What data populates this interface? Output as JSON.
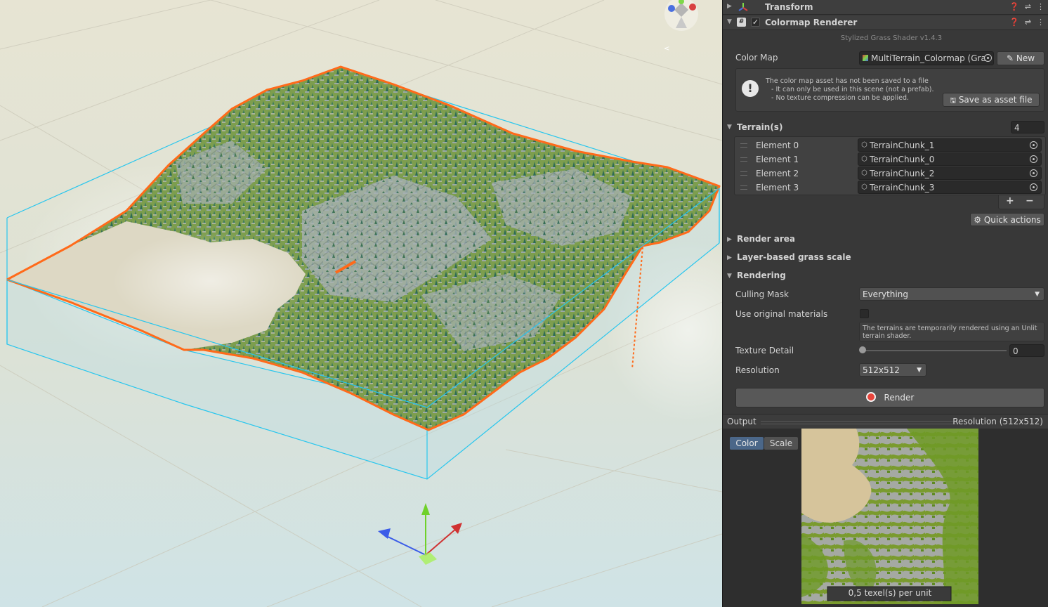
{
  "inspector": {
    "transform": {
      "title": "Transform"
    },
    "component": {
      "title": "Colormap Renderer",
      "version": "Stylized Grass Shader v1.4.3",
      "color_map": {
        "label": "Color Map",
        "value": "MultiTerrain_Colormap (Gras",
        "new_label": "New"
      },
      "warning": {
        "line1": "The color map asset has not been saved to a file",
        "line2": "- It can only be used in this scene (not a prefab).",
        "line3": "- No texture compression can be applied.",
        "save_label": "Save as asset file"
      },
      "terrains": {
        "label": "Terrain(s)",
        "count": "4",
        "elements": [
          {
            "label": "Element 0",
            "value": "TerrainChunk_1"
          },
          {
            "label": "Element 1",
            "value": "TerrainChunk_0"
          },
          {
            "label": "Element 2",
            "value": "TerrainChunk_2"
          },
          {
            "label": "Element 3",
            "value": "TerrainChunk_3"
          }
        ],
        "add": "+",
        "remove": "−"
      },
      "quick_actions": "Quick actions",
      "render_area": "Render area",
      "layer_scale": "Layer-based grass scale",
      "rendering": {
        "label": "Rendering",
        "culling_mask_label": "Culling Mask",
        "culling_mask_value": "Everything",
        "use_original_label": "Use original materials",
        "use_original_checked": false,
        "note_line1": "The terrains are temporarily rendered using an Unlit",
        "note_line2": "terrain shader.",
        "texture_detail_label": "Texture Detail",
        "texture_detail_value": "0",
        "resolution_label": "Resolution",
        "resolution_value": "512x512"
      },
      "render_button": "Render",
      "output": {
        "label": "Output",
        "resolution": "Resolution (512x512)",
        "tabs": [
          "Color",
          "Scale"
        ],
        "active_tab": "Color",
        "texel_label": "0,5 texel(s) per unit"
      }
    }
  },
  "colors": {
    "selection_orange": "#ff6a1a",
    "bounds_cyan": "#27c6ee",
    "accent_blue": "#4b6789",
    "record_red": "#e8453c"
  }
}
